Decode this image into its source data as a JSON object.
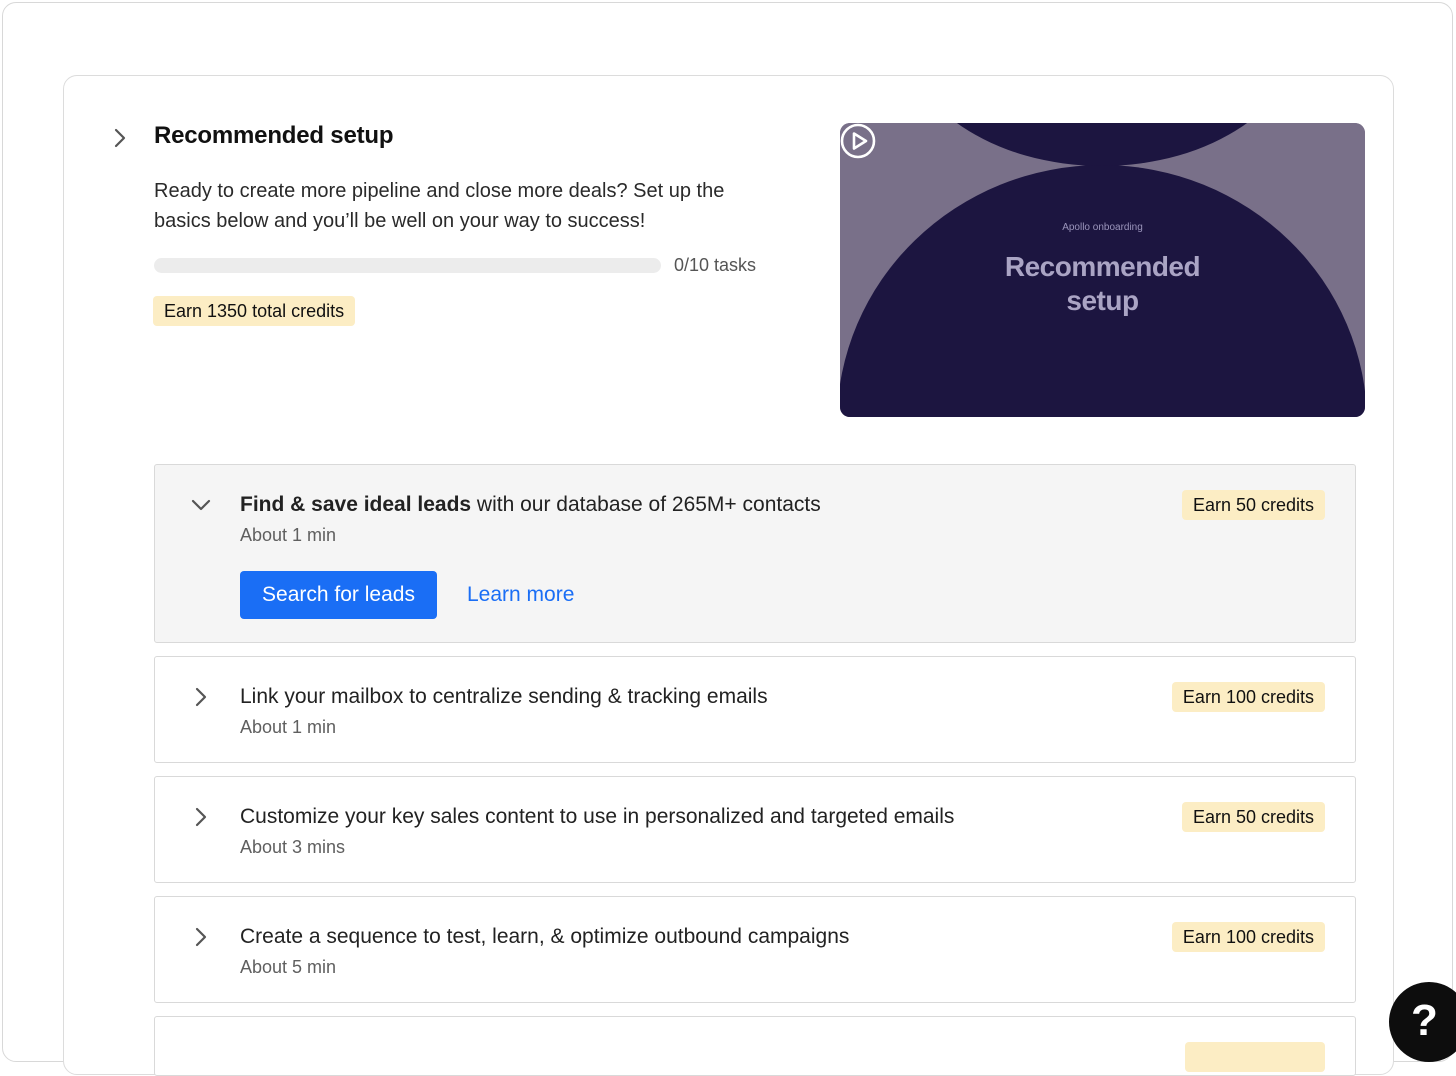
{
  "setup": {
    "title": "Recommended setup",
    "description": "Ready to create more pipeline and close more deals? Set up the basics below and you’ll be well on your way to success!",
    "progress_label": "0/10 tasks",
    "progress_fraction": 0,
    "total_credits_badge": "Earn 1350 total credits"
  },
  "video": {
    "kicker": "Apollo onboarding",
    "title_line1": "Recommended",
    "title_line2": "setup"
  },
  "tasks": [
    {
      "title_bold": "Find & save ideal leads",
      "title_rest": " with our database of 265M+ contacts",
      "time": "About 1 min",
      "credits": "Earn 50 credits",
      "primary_button": "Search for leads",
      "link": "Learn more"
    },
    {
      "title": "Link your mailbox to centralize sending & tracking emails",
      "time": "About 1 min",
      "credits": "Earn 100 credits"
    },
    {
      "title": "Customize your key sales content to use in personalized and targeted emails",
      "time": "About 3 mins",
      "credits": "Earn 50 credits"
    },
    {
      "title": "Create a sequence to test, learn, & optimize outbound campaigns",
      "time": "About 5 min",
      "credits": "Earn 100 credits"
    }
  ],
  "help": {
    "label": "?"
  },
  "colors": {
    "accent": "#1a6ef5",
    "badge_bg": "#fcedc4",
    "video_bg": "#1c1540"
  }
}
